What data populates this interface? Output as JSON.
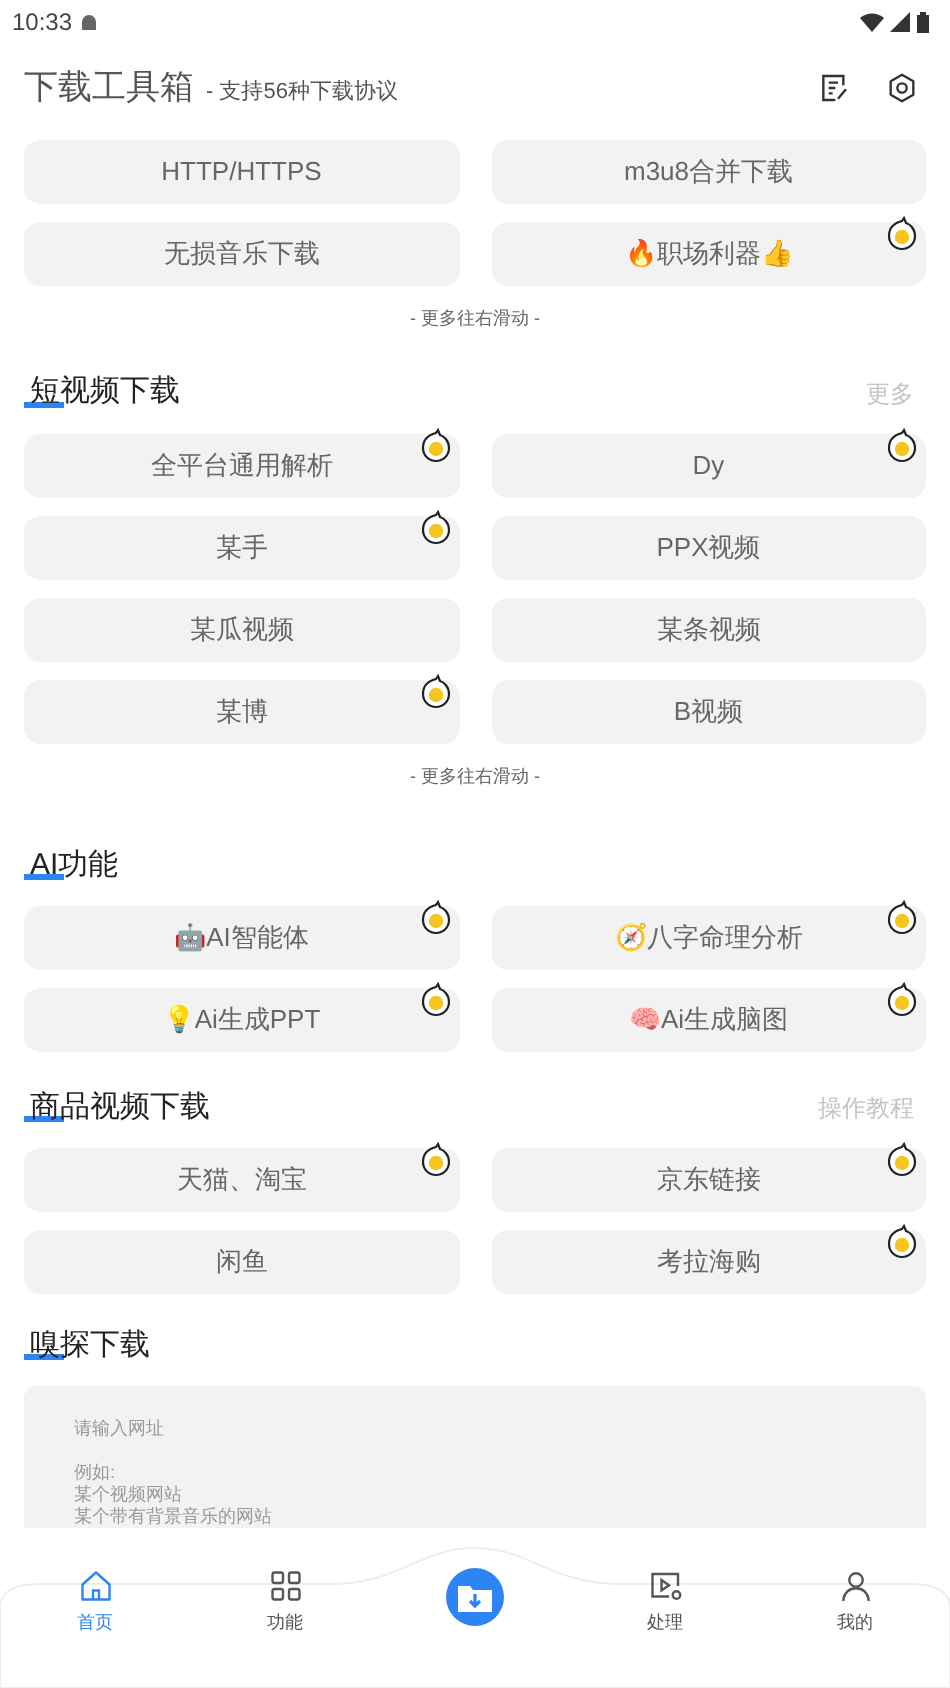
{
  "status_bar": {
    "time": "10:33"
  },
  "header": {
    "title": "下载工具箱",
    "subtitle": "- 支持56种下载协议"
  },
  "top_grid": {
    "items": [
      {
        "label": "HTTP/HTTPS",
        "hot": false
      },
      {
        "label": "m3u8合并下载",
        "hot": false
      },
      {
        "label": "无损音乐下载",
        "hot": false
      },
      {
        "label": "🔥职场利器👍",
        "hot": true
      }
    ],
    "hint": "- 更多往右滑动 -"
  },
  "sections": [
    {
      "title": "短视频下载",
      "action": "更多",
      "hint": "- 更多往右滑动 -",
      "items": [
        {
          "label": "全平台通用解析",
          "hot": true
        },
        {
          "label": "Dy",
          "hot": true
        },
        {
          "label": "某手",
          "hot": true
        },
        {
          "label": "PPX视频",
          "hot": false
        },
        {
          "label": "某瓜视频",
          "hot": false
        },
        {
          "label": "某条视频",
          "hot": false
        },
        {
          "label": "某博",
          "hot": true
        },
        {
          "label": "B视频",
          "hot": false
        }
      ]
    },
    {
      "title": "AI功能",
      "items": [
        {
          "label": "🤖AI智能体",
          "hot": true
        },
        {
          "label": "🧭八字命理分析",
          "hot": true
        },
        {
          "label": "💡Ai生成PPT",
          "hot": true
        },
        {
          "label": "🧠Ai生成脑图",
          "hot": true
        }
      ]
    },
    {
      "title": "商品视频下载",
      "action": "操作教程",
      "items": [
        {
          "label": "天猫、淘宝",
          "hot": true
        },
        {
          "label": "京东链接",
          "hot": true
        },
        {
          "label": "闲鱼",
          "hot": false
        },
        {
          "label": "考拉海购",
          "hot": true
        }
      ]
    }
  ],
  "sniff": {
    "title": "嗅探下载",
    "placeholder_lines": [
      "请输入网址",
      "例如:",
      "某个视频网站",
      "某个带有背景音乐的网站"
    ]
  },
  "nav": [
    {
      "kind": "home",
      "label": "首页",
      "selected": true
    },
    {
      "kind": "grid",
      "label": "功能",
      "selected": false
    },
    {
      "kind": "center",
      "selected": false
    },
    {
      "kind": "process",
      "label": "处理",
      "selected": false
    },
    {
      "kind": "user",
      "label": "我的",
      "selected": false
    }
  ]
}
